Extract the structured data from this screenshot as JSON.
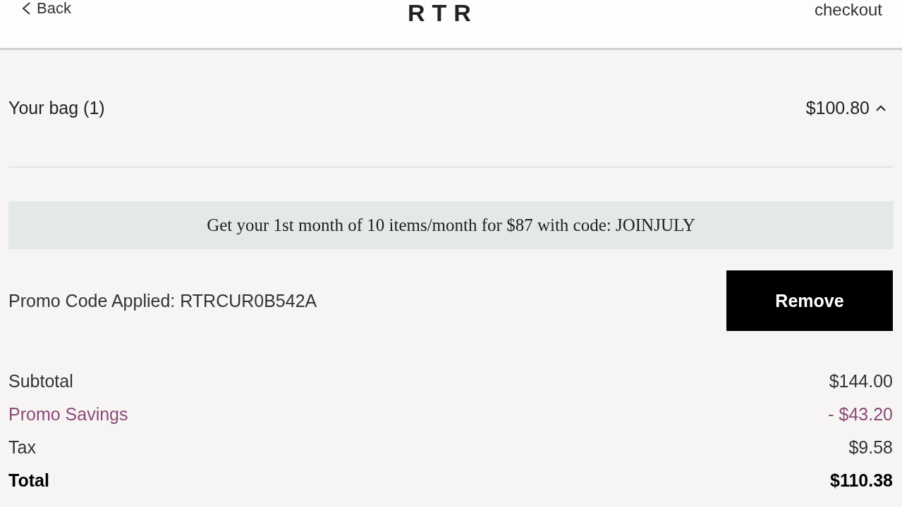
{
  "header": {
    "back": "Back",
    "logo": "RTR",
    "checkout": "checkout"
  },
  "bag": {
    "title": "Your bag (1)",
    "amount": "$100.80",
    "expanded": true
  },
  "banner": "Get your 1st month of 10 items/month for $87 with code: JOINJULY",
  "promo": {
    "label": "Promo Code Applied: RTRCUR0B542A",
    "button": "Remove"
  },
  "summary": [
    {
      "kind": "normal",
      "label": "Subtotal",
      "value": "$144.00"
    },
    {
      "kind": "promo",
      "label": "Promo Savings",
      "value": "- $43.20"
    },
    {
      "kind": "normal",
      "label": "Tax",
      "value": "$9.58"
    },
    {
      "kind": "total",
      "label": "Total",
      "value": "$110.38"
    }
  ]
}
